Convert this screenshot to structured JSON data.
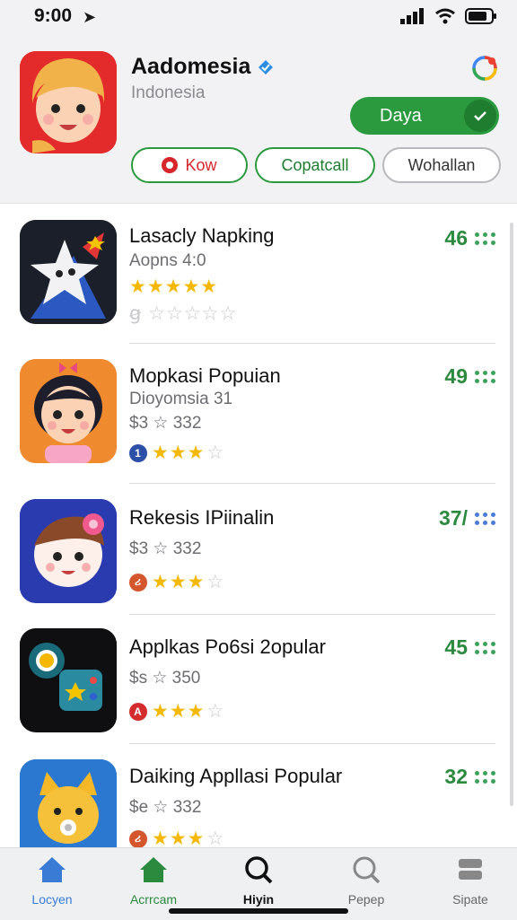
{
  "status": {
    "time": "9:00"
  },
  "developer": {
    "name": "Aadomesia",
    "subtitle": "Indonesia",
    "primary_button": "Daya",
    "chips": [
      "Kow",
      "Copatcall",
      "Wohallan"
    ]
  },
  "apps": [
    {
      "title": "Lasacly Napking",
      "subtitle": "Aopns 4:0",
      "rank": "46",
      "stars_filled": 5,
      "stars_total": 5,
      "second_row_filled": 0,
      "badge": "",
      "icon": "star-app-icon"
    },
    {
      "title": "Mopkasi Popuian",
      "subtitle": "Dioyomsia 31",
      "meta": "$3 ☆ 332",
      "rank": "49",
      "stars_filled": 3,
      "stars_total": 4,
      "badge": "1",
      "badge_color": "#2c4fa8",
      "icon": "girl-app-icon"
    },
    {
      "title": "Rekesis IPiinalin",
      "meta": "$3 ☆ 332",
      "rank": "37/",
      "stars_filled": 3,
      "stars_total": 4,
      "badge": "ሪ",
      "badge_color": "#d4562c",
      "icon": "boy-app-icon"
    },
    {
      "title": "Applkas Po6si 2opular",
      "meta": "$s ☆ 350",
      "rank": "45",
      "stars_filled": 3,
      "stars_total": 4,
      "badge": "A",
      "badge_color": "#d42c2c",
      "icon": "game-app-icon"
    },
    {
      "title": "Daiking Appllasi Popular",
      "meta": "$e ☆ 332",
      "rank": "32",
      "stars_filled": 3,
      "stars_total": 4,
      "badge": "ሪ",
      "badge_color": "#d4562c",
      "icon": "cat-app-icon"
    }
  ],
  "tabs": [
    {
      "label": "Locyen",
      "color": "#3a7bd5"
    },
    {
      "label": "Acrrcam",
      "color": "#2b8a3e"
    },
    {
      "label": "Hiyin",
      "color": "#111111"
    },
    {
      "label": "Pepep",
      "color": "#888888"
    },
    {
      "label": "Sipate",
      "color": "#888888"
    }
  ]
}
